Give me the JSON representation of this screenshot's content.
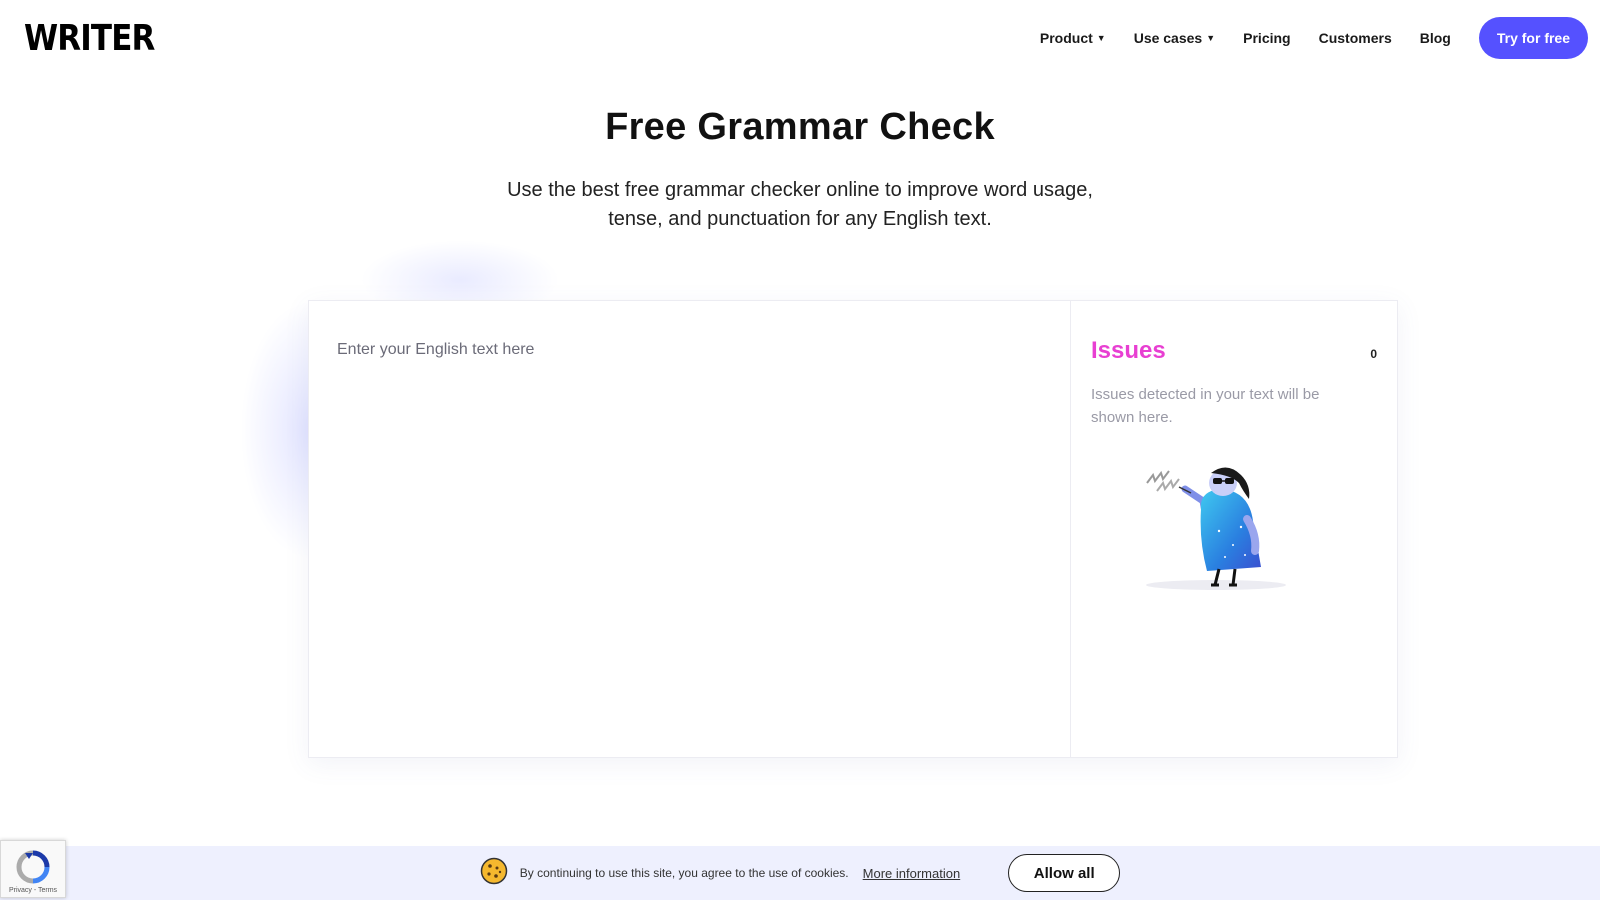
{
  "header": {
    "logo": "WRITER",
    "nav": [
      {
        "label": "Product",
        "dropdown": true
      },
      {
        "label": "Use cases",
        "dropdown": true
      },
      {
        "label": "Pricing",
        "dropdown": false
      },
      {
        "label": "Customers",
        "dropdown": false
      },
      {
        "label": "Blog",
        "dropdown": false
      }
    ],
    "cta_label": "Try for free"
  },
  "hero": {
    "title": "Free Grammar Check",
    "subtitle_line1": "Use the best free grammar checker online to improve word usage,",
    "subtitle_line2": "tense, and punctuation for any English text."
  },
  "checker": {
    "placeholder": "Enter your English text here",
    "issues_title": "Issues",
    "issues_count": "0",
    "issues_description": "Issues detected in your text will be shown here."
  },
  "cookie": {
    "text": "By continuing to use this site, you agree to the use of cookies.",
    "link": "More information",
    "allow_label": "Allow all"
  },
  "recaptcha": {
    "links": "Privacy - Terms"
  },
  "colors": {
    "brand": "#5551ff",
    "issues_accent": "#e83fd2",
    "cookie_bg": "#eef0fe"
  },
  "icons": [
    "chevron-down-icon",
    "cookie-icon",
    "recaptcha-icon"
  ]
}
